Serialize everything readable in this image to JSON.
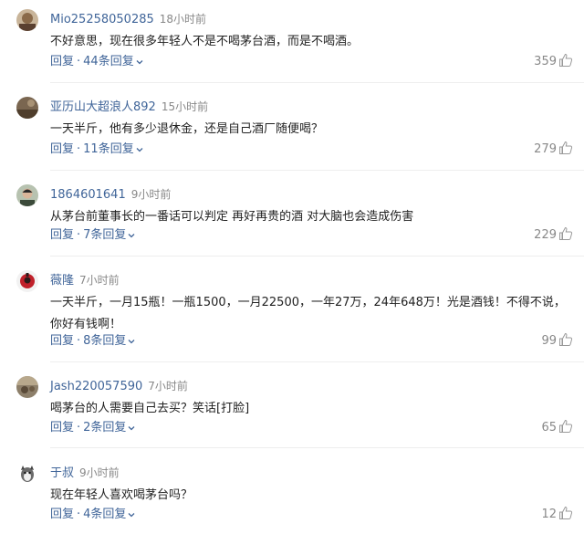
{
  "comments": [
    {
      "username": "Mio25258050285",
      "time": "18小时前",
      "text": "不好意思，现在很多年轻人不是不喝茅台酒，而是不喝酒。",
      "reply_label": "回复",
      "replies_label": "44条回复",
      "likes": "359"
    },
    {
      "username": "亚历山大超浪人892",
      "time": "15小时前",
      "text": "一天半斤，他有多少退休金，还是自己酒厂随便喝？",
      "reply_label": "回复",
      "replies_label": "11条回复",
      "likes": "279"
    },
    {
      "username": "1864601641",
      "time": "9小时前",
      "text": "从茅台前董事长的一番话可以判定 再好再贵的酒 对大脑也会造成伤害",
      "reply_label": "回复",
      "replies_label": "7条回复",
      "likes": "229"
    },
    {
      "username": "薇隆",
      "time": "7小时前",
      "text": "一天半斤，一月15瓶！一瓶1500，一月22500，一年27万，24年648万！光是酒钱！不得不说，你好有钱啊！",
      "reply_label": "回复",
      "replies_label": "8条回复",
      "likes": "99"
    },
    {
      "username": "Jash220057590",
      "time": "7小时前",
      "text": "喝茅台的人需要自己去买？笑话[打脸]",
      "reply_label": "回复",
      "replies_label": "2条回复",
      "likes": "65"
    },
    {
      "username": "于叔",
      "time": "9小时前",
      "text": "现在年轻人喜欢喝茅台吗？",
      "reply_label": "回复",
      "replies_label": "4条回复",
      "likes": "12"
    }
  ],
  "colors": {
    "link": "#406599",
    "meta": "#888888",
    "text": "#222222"
  }
}
